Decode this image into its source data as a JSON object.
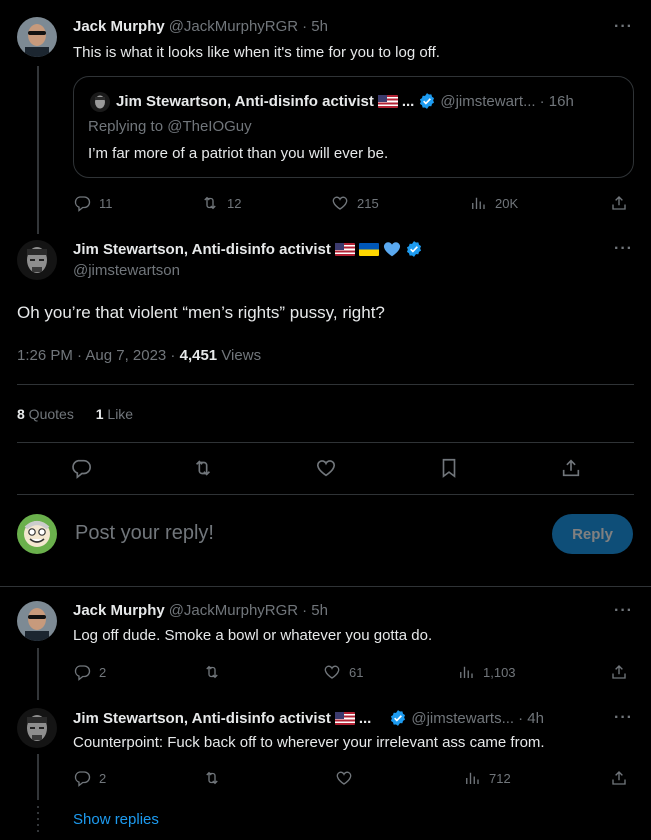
{
  "tweet1": {
    "name": "Jack Murphy",
    "handle": "@JackMurphyRGR",
    "time": "· 5h",
    "text": "This is what it looks like when it's time for you to log off.",
    "quote": {
      "name": "Jim Stewartson, Anti-disinfo activist",
      "ellipsis": "...",
      "handle": "@jimstewart...",
      "time": "· 16h",
      "replying": "Replying to @TheIOGuy",
      "text": "I’m far more of a patriot than you will ever be."
    },
    "stats": {
      "replies": "11",
      "retweets": "12",
      "likes": "215",
      "views": "20K"
    }
  },
  "main": {
    "name": "Jim Stewartson, Anti-disinfo activist",
    "handle": "@jimstewartson",
    "text": "Oh you’re that violent “men’s rights” pussy, right?",
    "timestamp": "1:26 PM · Aug 7, 2023 · ",
    "views_count": "4,451",
    "views_label": " Views",
    "quotes_count": "8",
    "quotes_label": " Quotes",
    "likes_count": "1",
    "likes_label": " Like"
  },
  "compose": {
    "placeholder": "Post your reply!",
    "button": "Reply"
  },
  "reply1": {
    "name": "Jack Murphy",
    "handle": "@JackMurphyRGR",
    "time": "· 5h",
    "text": "Log off dude. Smoke a bowl or whatever you gotta do.",
    "stats": {
      "replies": "2",
      "likes": "61",
      "views": "1,103"
    }
  },
  "reply2": {
    "name": "Jim Stewartson, Anti-disinfo activist",
    "ellipsis": "...",
    "handle": "@jimstewarts...",
    "time": "· 4h",
    "text": "Counterpoint: Fuck back off to wherever your irrelevant ass came from.",
    "stats": {
      "replies": "2",
      "views": "712"
    }
  },
  "show_replies": "Show replies",
  "more_glyph": "···",
  "colors": {
    "accent": "#1d9bf0",
    "background": "#000000",
    "muted": "#71767b",
    "divider": "#2f3336"
  }
}
